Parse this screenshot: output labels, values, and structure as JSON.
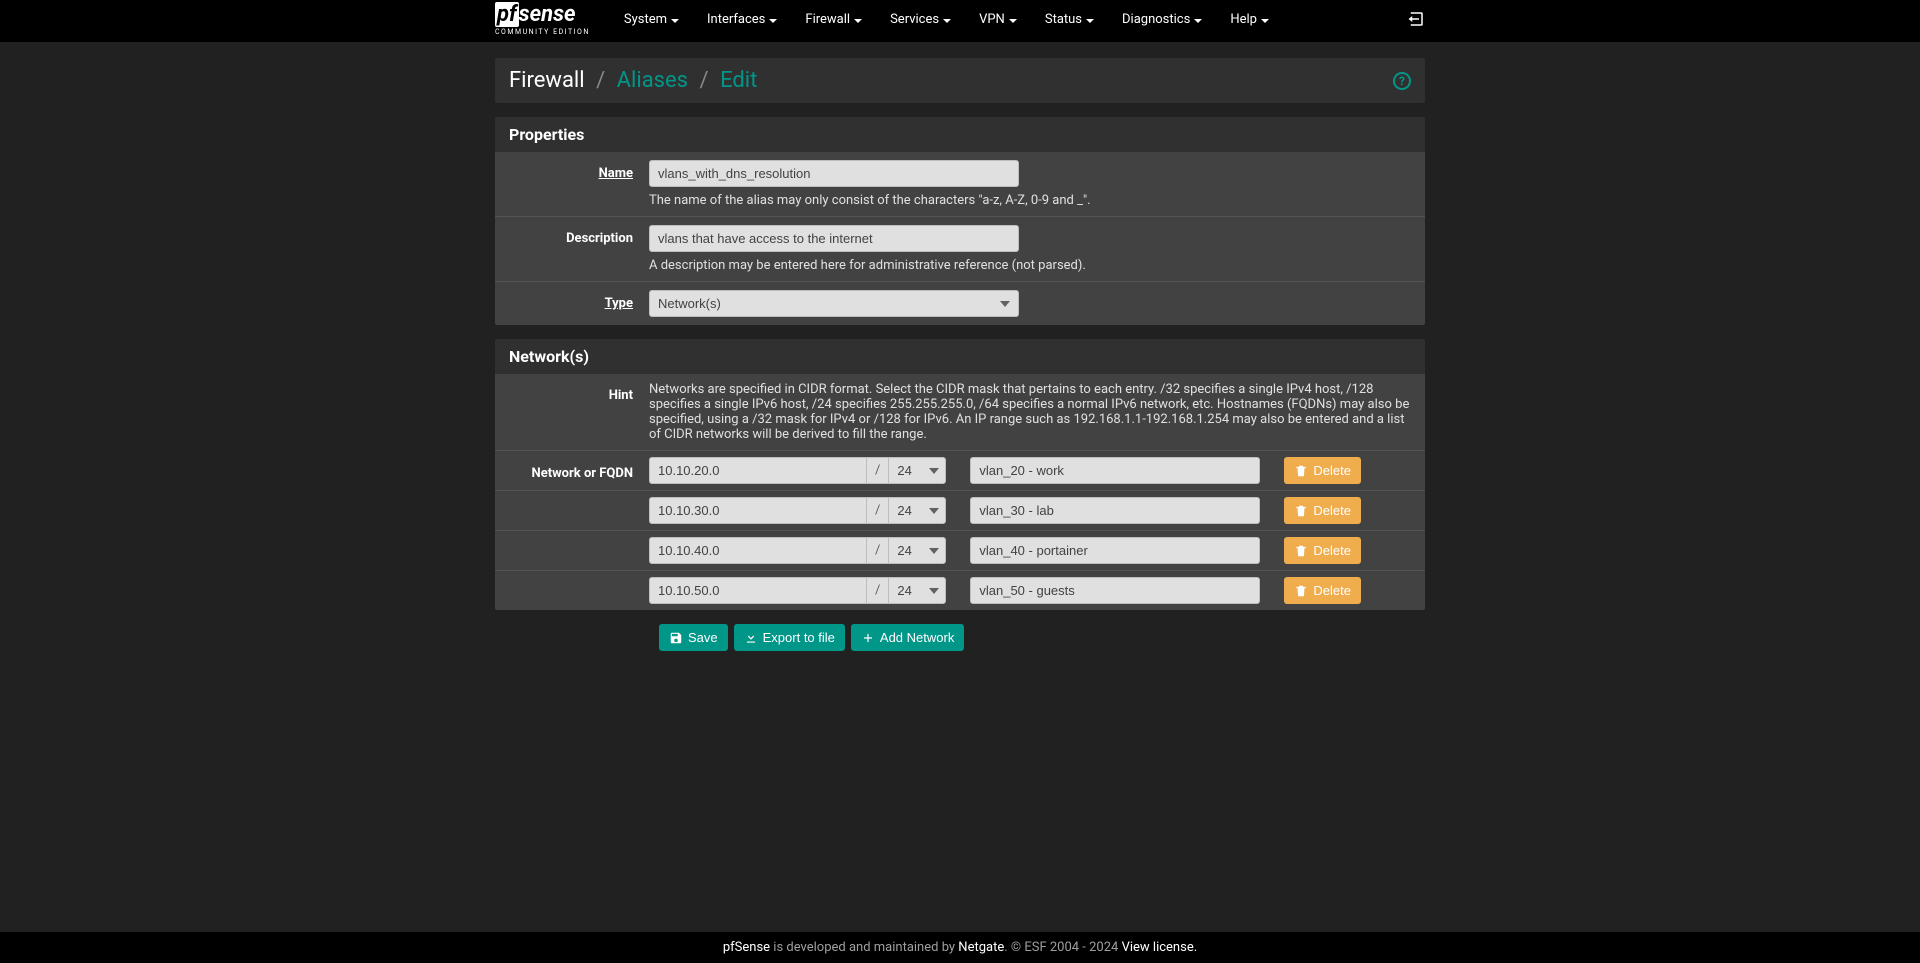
{
  "brand": {
    "pf": "pf",
    "sense": "sense",
    "sub": "COMMUNITY EDITION"
  },
  "nav": {
    "items": [
      {
        "label": "System"
      },
      {
        "label": "Interfaces"
      },
      {
        "label": "Firewall"
      },
      {
        "label": "Services"
      },
      {
        "label": "VPN"
      },
      {
        "label": "Status"
      },
      {
        "label": "Diagnostics"
      },
      {
        "label": "Help"
      }
    ]
  },
  "breadcrumb": {
    "root": "Firewall",
    "mid": "Aliases",
    "leaf": "Edit"
  },
  "panels": {
    "properties": {
      "title": "Properties",
      "name_label": "Name",
      "name_value": "vlans_with_dns_resolution",
      "name_help": "The name of the alias may only consist of the characters \"a-z, A-Z, 0-9 and _\".",
      "desc_label": "Description",
      "desc_value": "vlans that have access to the internet",
      "desc_help": "A description may be entered here for administrative reference (not parsed).",
      "type_label": "Type",
      "type_value": "Network(s)"
    },
    "networks": {
      "title": "Network(s)",
      "hint_label": "Hint",
      "hint_text": "Networks are specified in CIDR format. Select the CIDR mask that pertains to each entry. /32 specifies a single IPv4 host, /128 specifies a single IPv6 host, /24 specifies 255.255.255.0, /64 specifies a normal IPv6 network, etc. Hostnames (FQDNs) may also be specified, using a /32 mask for IPv4 or /128 for IPv6. An IP range such as 192.168.1.1-192.168.1.254 may also be entered and a list of CIDR networks will be derived to fill the range.",
      "field_label": "Network or FQDN",
      "slash": "/",
      "delete_label": "Delete",
      "rows": [
        {
          "net": "10.10.20.0",
          "mask": "24",
          "desc": "vlan_20 - work"
        },
        {
          "net": "10.10.30.0",
          "mask": "24",
          "desc": "vlan_30 - lab"
        },
        {
          "net": "10.10.40.0",
          "mask": "24",
          "desc": "vlan_40 - portainer"
        },
        {
          "net": "10.10.50.0",
          "mask": "24",
          "desc": "vlan_50 - guests"
        }
      ]
    }
  },
  "actions": {
    "save": "Save",
    "export": "Export to file",
    "add": "Add Network"
  },
  "footer": {
    "pfsense": "pfSense",
    "mid": " is developed and maintained by ",
    "netgate": "Netgate",
    "copyright": ". © ESF 2004 - 2024 ",
    "view": "View license."
  }
}
